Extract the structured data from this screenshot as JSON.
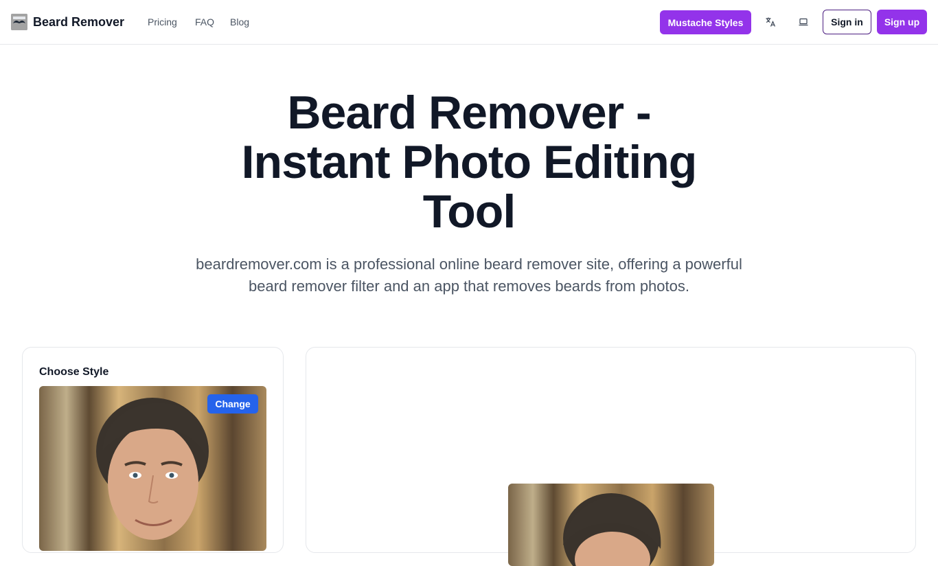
{
  "header": {
    "brand": "Beard Remover",
    "logo_icon": "mustache-logo-icon",
    "nav": [
      "Pricing",
      "FAQ",
      "Blog"
    ],
    "mustache_button": "Mustache Styles",
    "translate_icon": "translate-icon",
    "theme_icon": "laptop-icon",
    "signin": "Sign in",
    "signup": "Sign up",
    "accent_color": "#9333ea"
  },
  "hero": {
    "title_lines": [
      "Beard Remover -",
      "Instant Photo Editing",
      "Tool"
    ],
    "subtitle": "beardremover.com is a professional online beard remover site, offering a powerful beard remover filter and an app that removes beards from photos."
  },
  "style_panel": {
    "title": "Choose Style",
    "change_button": "Change",
    "change_color": "#2563eb"
  }
}
